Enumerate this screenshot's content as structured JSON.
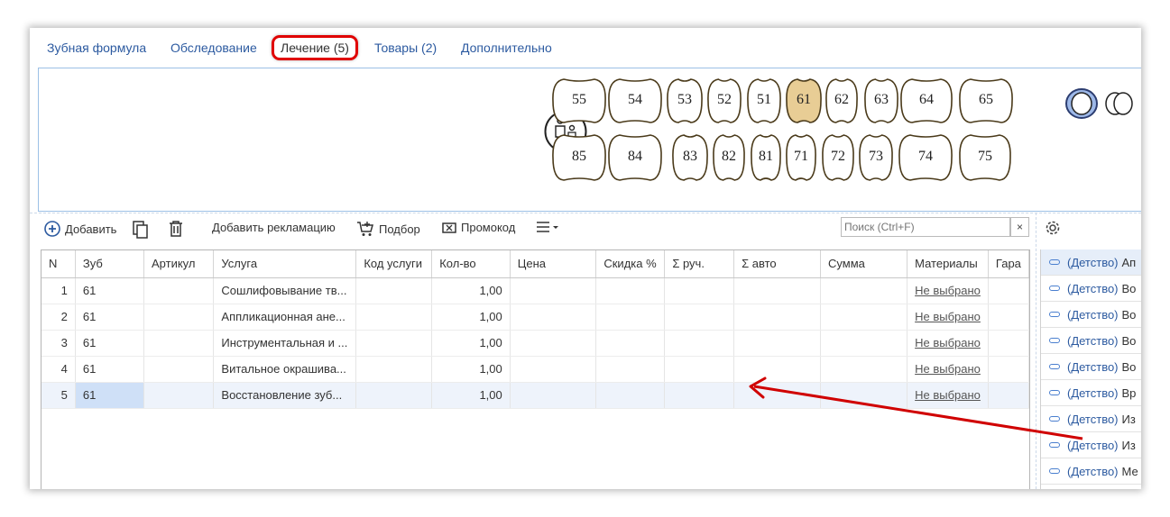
{
  "tabs": [
    {
      "label": "Зубная формула"
    },
    {
      "label": "Обследование"
    },
    {
      "label": "Лечение (5)"
    },
    {
      "label": "Товары (2)"
    },
    {
      "label": "Дополнительно"
    }
  ],
  "teeth": {
    "upper": [
      "55",
      "54",
      "53",
      "52",
      "51",
      "61",
      "62",
      "63",
      "64",
      "65"
    ],
    "lower": [
      "85",
      "84",
      "83",
      "82",
      "81",
      "71",
      "72",
      "73",
      "74",
      "75"
    ],
    "selected": "61"
  },
  "toolbar": {
    "add": "Добавить",
    "add_claim": "Добавить рекламацию",
    "selection": "Подбор",
    "promo": "Промокод"
  },
  "search": {
    "placeholder": "Поиск (Ctrl+F)",
    "clear": "×"
  },
  "table": {
    "columns": [
      "N",
      "Зуб",
      "Артикул",
      "Услуга",
      "Код услуги",
      "Кол-во",
      "Цена",
      "Скидка %",
      "Σ руч.",
      "Σ авто",
      "Сумма",
      "Материалы",
      "Гара"
    ],
    "rows": [
      {
        "n": "1",
        "tooth": "61",
        "service": "Сошлифовывание тв...",
        "qty": "1,00",
        "materials": "Не выбрано"
      },
      {
        "n": "2",
        "tooth": "61",
        "service": "Аппликационная ане...",
        "qty": "1,00",
        "materials": "Не выбрано"
      },
      {
        "n": "3",
        "tooth": "61",
        "service": "Инструментальная и ...",
        "qty": "1,00",
        "materials": "Не выбрано"
      },
      {
        "n": "4",
        "tooth": "61",
        "service": "Витальное окрашива...",
        "qty": "1,00",
        "materials": "Не выбрано"
      },
      {
        "n": "5",
        "tooth": "61",
        "service": "Восстановление зуб...",
        "qty": "1,00",
        "materials": "Не выбрано"
      }
    ]
  },
  "right_panel": {
    "items": [
      {
        "cat": "(Детство)",
        "text": "Ап"
      },
      {
        "cat": "(Детство)",
        "text": "Во"
      },
      {
        "cat": "(Детство)",
        "text": "Во"
      },
      {
        "cat": "(Детство)",
        "text": "Во"
      },
      {
        "cat": "(Детство)",
        "text": "Во"
      },
      {
        "cat": "(Детство)",
        "text": "Вр"
      },
      {
        "cat": "(Детство)",
        "text": "Из"
      },
      {
        "cat": "(Детство)",
        "text": "Из"
      },
      {
        "cat": "(Детство)",
        "text": "Ме"
      }
    ]
  },
  "colors": {
    "link": "#2c5aa0",
    "highlight": "#e00000",
    "selected_tooth": "#e8cd95",
    "arrow": "#d00000"
  }
}
